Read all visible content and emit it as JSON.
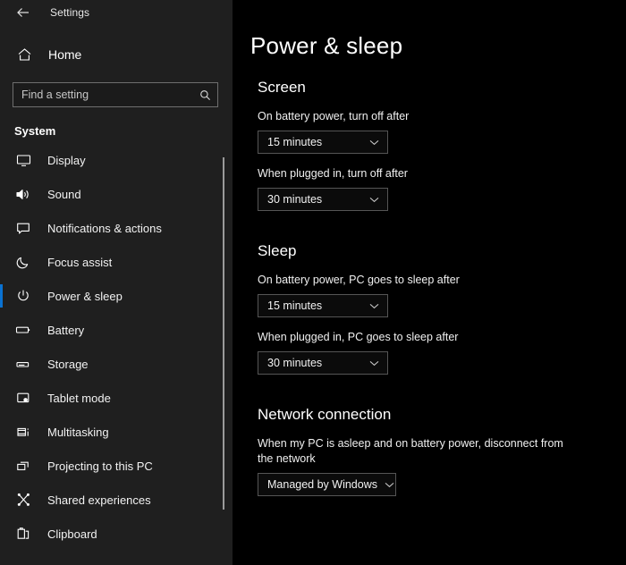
{
  "window": {
    "titlebar_title": "Settings",
    "back_icon": "back-arrow-icon"
  },
  "sidebar": {
    "home_label": "Home",
    "home_icon": "home-icon",
    "search": {
      "placeholder": "Find a setting",
      "value": "",
      "icon": "search-icon"
    },
    "section_title": "System",
    "selected_item": "Power & sleep",
    "accent_color": "#0a72d2",
    "background_color": "#1f1f1f",
    "items": [
      {
        "label": "Display",
        "icon": "monitor-icon",
        "selected": false
      },
      {
        "label": "Sound",
        "icon": "speaker-icon",
        "selected": false
      },
      {
        "label": "Notifications & actions",
        "icon": "notification-bubble-icon",
        "selected": false
      },
      {
        "label": "Focus assist",
        "icon": "moon-icon",
        "selected": false
      },
      {
        "label": "Power & sleep",
        "icon": "power-icon",
        "selected": true
      },
      {
        "label": "Battery",
        "icon": "battery-icon",
        "selected": false
      },
      {
        "label": "Storage",
        "icon": "storage-icon",
        "selected": false
      },
      {
        "label": "Tablet mode",
        "icon": "tablet-mode-icon",
        "selected": false
      },
      {
        "label": "Multitasking",
        "icon": "multitasking-icon",
        "selected": false
      },
      {
        "label": "Projecting to this PC",
        "icon": "projecting-icon",
        "selected": false
      },
      {
        "label": "Shared experiences",
        "icon": "shared-experiences-icon",
        "selected": false
      },
      {
        "label": "Clipboard",
        "icon": "clipboard-icon",
        "selected": false
      }
    ]
  },
  "main": {
    "page_title": "Power & sleep",
    "background_color": "#000000",
    "groups": [
      {
        "title": "Screen",
        "fields": [
          {
            "label": "On battery power, turn off after",
            "dropdown_value": "15 minutes",
            "chevron_icon": "chevron-down-icon"
          },
          {
            "label": "When plugged in, turn off after",
            "dropdown_value": "30 minutes",
            "chevron_icon": "chevron-down-icon"
          }
        ]
      },
      {
        "title": "Sleep",
        "fields": [
          {
            "label": "On battery power, PC goes to sleep after",
            "dropdown_value": "15 minutes",
            "chevron_icon": "chevron-down-icon"
          },
          {
            "label": "When plugged in, PC goes to sleep after",
            "dropdown_value": "30 minutes",
            "chevron_icon": "chevron-down-icon"
          }
        ]
      },
      {
        "title": "Network connection",
        "fields": [
          {
            "label": "When my PC is asleep and on battery power, disconnect from the network",
            "dropdown_value": "Managed by Windows",
            "chevron_icon": "chevron-down-icon"
          }
        ]
      }
    ]
  }
}
